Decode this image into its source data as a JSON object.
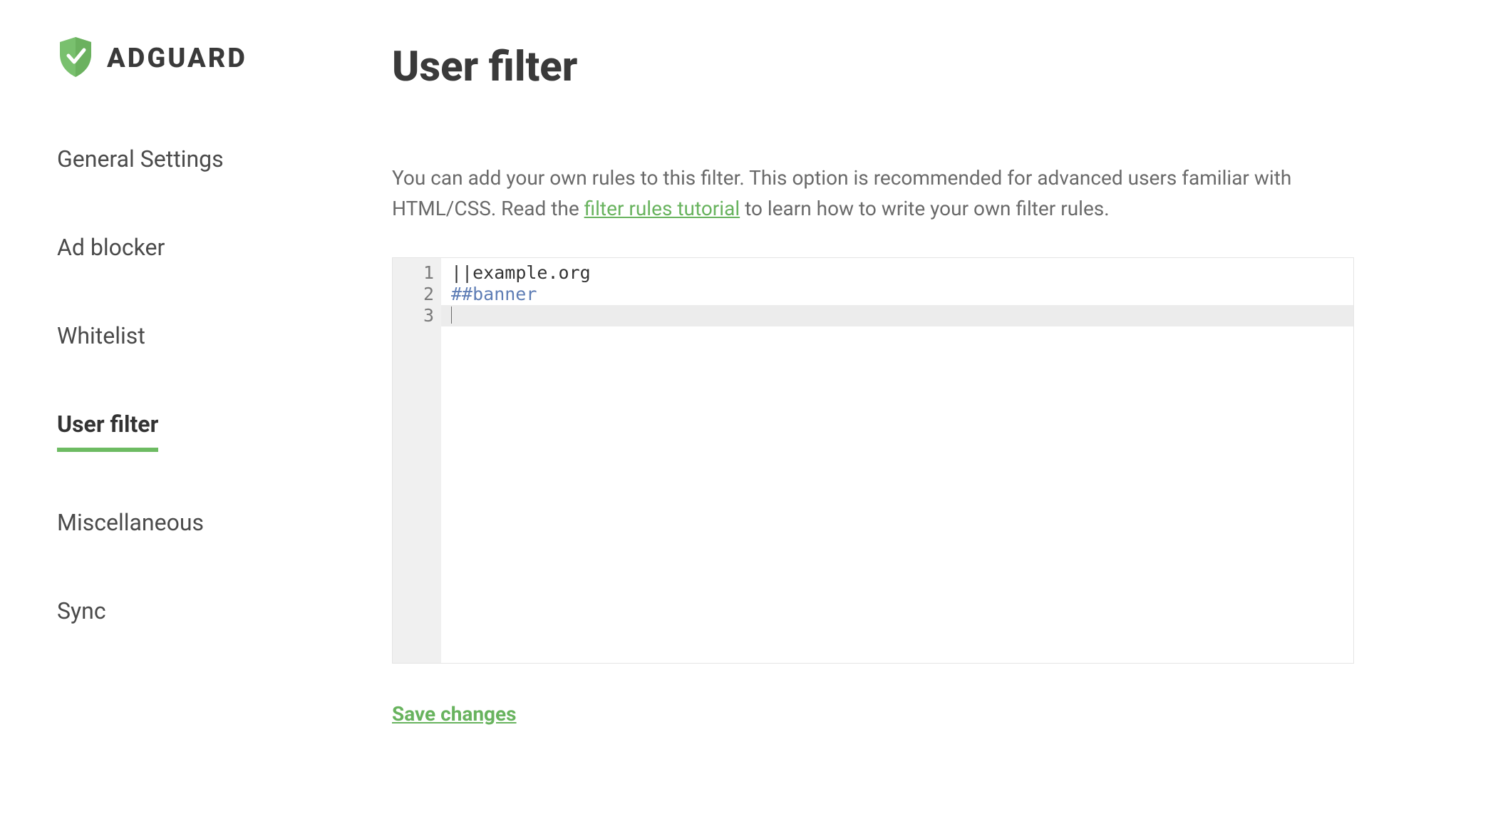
{
  "brand": {
    "name": "ADGUARD"
  },
  "sidebar": {
    "items": [
      {
        "label": "General Settings",
        "active": false
      },
      {
        "label": "Ad blocker",
        "active": false
      },
      {
        "label": "Whitelist",
        "active": false
      },
      {
        "label": "User filter",
        "active": true
      },
      {
        "label": "Miscellaneous",
        "active": false
      },
      {
        "label": "Sync",
        "active": false
      }
    ]
  },
  "main": {
    "title": "User filter",
    "description_pre": "You can add your own rules to this filter. This option is recommended for advanced users familiar with HTML/CSS. Read the ",
    "description_link": "filter rules tutorial",
    "description_post": " to learn how to write your own filter rules."
  },
  "editor": {
    "gutter": [
      "1",
      "2",
      "3"
    ],
    "line1_op": "||",
    "line1_domain": "example.org",
    "line2": "##banner",
    "active_line_index": 2
  },
  "actions": {
    "save": "Save changes"
  },
  "colors": {
    "accent": "#68b35e"
  }
}
